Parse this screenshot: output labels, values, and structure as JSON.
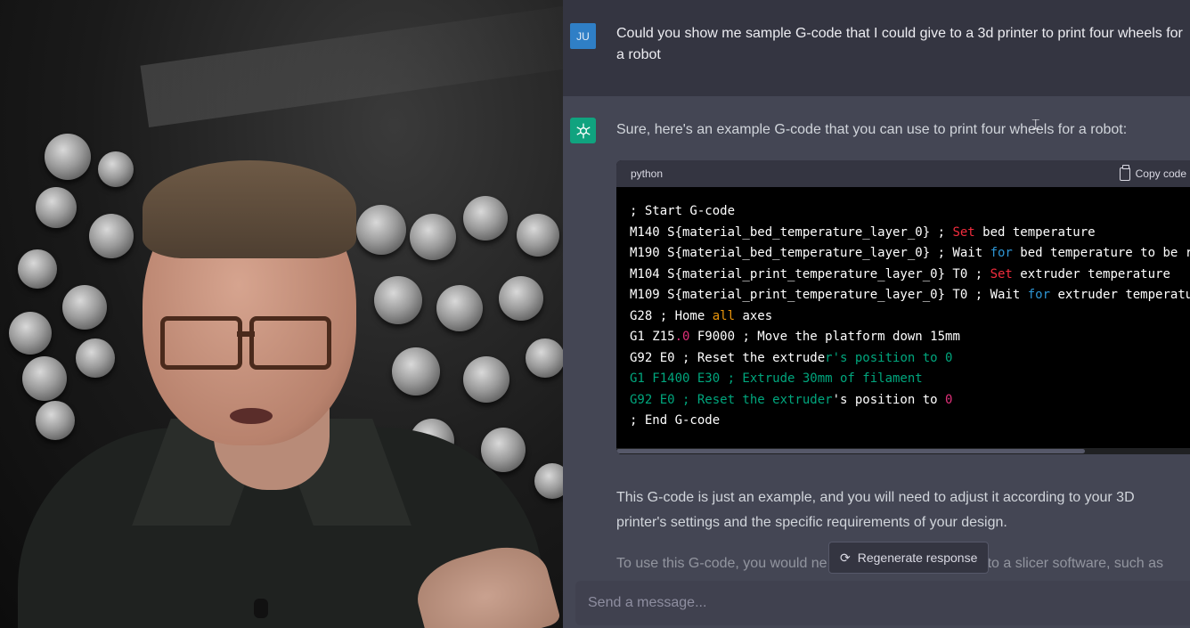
{
  "conversation": {
    "user_avatar": "JU",
    "user_message": "Could you show me sample G-code that I could give to a 3d printer to print four wheels for a robot",
    "assistant_intro": "Sure, here's an example G-code that you can use to print four wheels for a robot:",
    "code_language": "python",
    "copy_label": "Copy code",
    "paragraph_1": "This G-code is just an example, and you will need to adjust it according to your 3D printer's settings and the specific requirements of your design.",
    "paragraph_2_start": "To use this G-code, you would ne",
    "paragraph_2_end": "to a slicer software, such as"
  },
  "code_lines": [
    [
      {
        "t": "; Start G-code",
        "c": ""
      }
    ],
    [
      {
        "t": "M140 S{material_bed_temperature_layer_0} ; ",
        "c": ""
      },
      {
        "t": "Set",
        "c": "kw"
      },
      {
        "t": " bed temperature",
        "c": ""
      }
    ],
    [
      {
        "t": "M190 S{material_bed_temperature_layer_0} ; Wait ",
        "c": ""
      },
      {
        "t": "for",
        "c": "blue"
      },
      {
        "t": " bed temperature to be re",
        "c": ""
      }
    ],
    [
      {
        "t": "M104 S{material_print_temperature_layer_0} T0 ; ",
        "c": ""
      },
      {
        "t": "Set",
        "c": "kw"
      },
      {
        "t": " extruder temperature",
        "c": ""
      }
    ],
    [
      {
        "t": "M109 S{material_print_temperature_layer_0} T0 ; Wait ",
        "c": ""
      },
      {
        "t": "for",
        "c": "blue"
      },
      {
        "t": " extruder temperatur",
        "c": ""
      }
    ],
    [
      {
        "t": "G28 ; Home ",
        "c": ""
      },
      {
        "t": "all",
        "c": "gold"
      },
      {
        "t": " axes",
        "c": ""
      }
    ],
    [
      {
        "t": "G1 Z15",
        "c": ""
      },
      {
        "t": ".0",
        "c": "num"
      },
      {
        "t": " F9000 ; Move the platform down 15mm",
        "c": ""
      }
    ],
    [
      {
        "t": "G92 E0 ; Reset the extrude",
        "c": ""
      },
      {
        "t": "r's position to 0",
        "c": "green"
      }
    ],
    [
      {
        "t": "G1 F1400 E30 ; Extrude 30mm of filament",
        "c": "green"
      }
    ],
    [
      {
        "t": "G92 E0 ; Reset the extruder",
        "c": "green"
      },
      {
        "t": "'s position to ",
        "c": ""
      },
      {
        "t": "0",
        "c": "num"
      }
    ],
    [
      {
        "t": "; End G-code",
        "c": ""
      }
    ]
  ],
  "controls": {
    "regenerate_label": "Regenerate response",
    "input_placeholder": "Send a message..."
  },
  "colors": {
    "accent_green": "#10a37f",
    "user_avatar_bg": "#2f7fc6"
  },
  "icons": {
    "bot_avatar": "openai-logo-icon",
    "copy": "clipboard-icon",
    "regenerate": "refresh-icon",
    "text_cursor": "ibeam-cursor-icon"
  }
}
